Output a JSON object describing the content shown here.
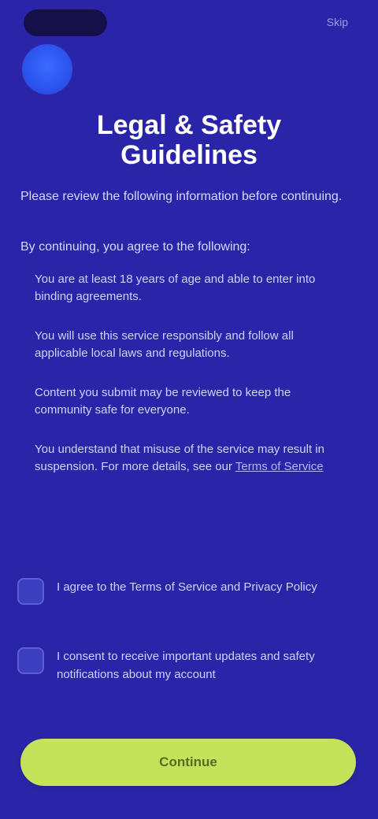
{
  "status_bar": {
    "right_text": "Skip"
  },
  "header": {
    "title_line1": "Legal & Safety",
    "title_line2": "Guidelines"
  },
  "intro": "Please review the following information before continuing.",
  "subhead": "By continuing, you agree to the following:",
  "list_items": [
    "You are at least 18 years of age and able to enter into binding agreements.",
    "You will use this service responsibly and follow all applicable local laws and regulations.",
    "Content you submit may be reviewed to keep the community safe for everyone.",
    "You understand that misuse of the service may result in suspension. For more details, see our "
  ],
  "list_link": "Terms of Service",
  "consents": [
    {
      "text": "I agree to the Terms of Service and Privacy Policy"
    },
    {
      "text": "I consent to receive important updates and safety notifications about my account"
    }
  ],
  "cta_label": "Continue"
}
